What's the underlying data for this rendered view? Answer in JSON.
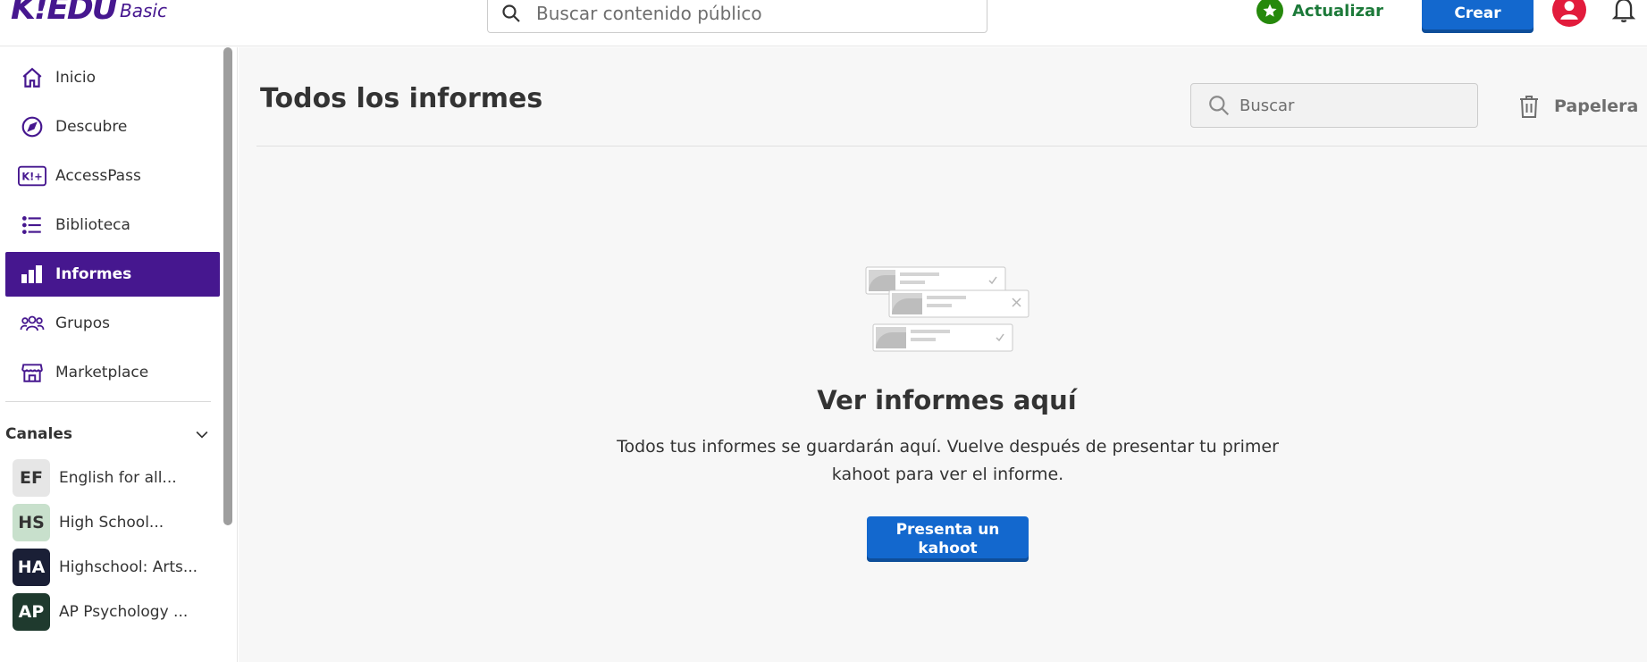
{
  "header": {
    "logo_text": "K!EDU",
    "logo_plan": "Basic",
    "search_placeholder": "Buscar contenido público",
    "upgrade_label": "Actualizar",
    "create_label": "Crear",
    "icons": [
      "search-icon",
      "star-icon",
      "user-avatar-icon",
      "bell-icon"
    ]
  },
  "sidebar": {
    "items": [
      {
        "label": "Inicio",
        "icon": "home-icon",
        "active": false
      },
      {
        "label": "Descubre",
        "icon": "compass-icon",
        "active": false
      },
      {
        "label": "AccessPass",
        "icon": "accesspass-icon",
        "active": false
      },
      {
        "label": "Biblioteca",
        "icon": "list-icon",
        "active": false
      },
      {
        "label": "Informes",
        "icon": "bar-chart-icon",
        "active": true
      },
      {
        "label": "Grupos",
        "icon": "group-icon",
        "active": false
      },
      {
        "label": "Marketplace",
        "icon": "store-icon",
        "active": false
      }
    ],
    "channels_label": "Canales",
    "channels": [
      {
        "initials": "EF",
        "label": "English for all...",
        "bg": "#e6e6e6",
        "fg": "#333333"
      },
      {
        "initials": "HS",
        "label": "High School...",
        "bg": "#c8e0cc",
        "fg": "#333333"
      },
      {
        "initials": "HA",
        "label": "Highschool: Arts...",
        "bg": "#1a1f36",
        "fg": "#ffffff"
      },
      {
        "initials": "AP",
        "label": "AP Psychology ...",
        "bg": "#1f3a2e",
        "fg": "#ffffff"
      }
    ]
  },
  "main": {
    "title": "Todos los informes",
    "search_placeholder": "Buscar",
    "trash_label": "Papelera",
    "empty_title": "Ver informes aquí",
    "empty_text": "Todos tus informes se guardarán aquí. Vuelve después de presentar tu primer kahoot para ver el informe.",
    "host_button_label": "Presenta un kahoot"
  },
  "colors": {
    "brand": "#46178f",
    "primary_button": "#1368ce",
    "upgrade_green": "#26890c",
    "avatar_red": "#e21b3c"
  }
}
